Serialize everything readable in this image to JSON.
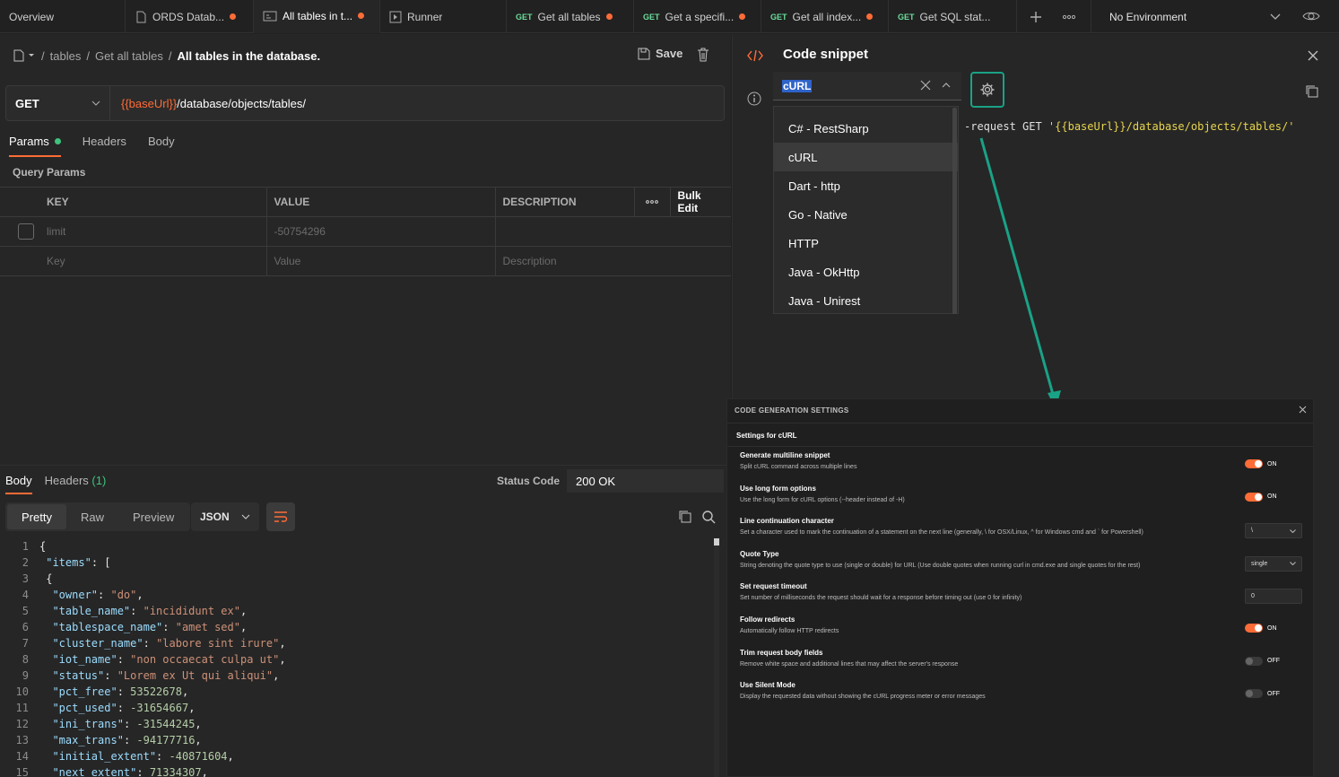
{
  "tabs": [
    {
      "label": "Overview",
      "method": "",
      "dirty": false,
      "active": false
    },
    {
      "label": "ORDS Datab...",
      "method": "",
      "dirty": true,
      "active": false
    },
    {
      "label": "All tables in t...",
      "method": "",
      "dirty": true,
      "active": true
    },
    {
      "label": "Runner",
      "method": "",
      "dirty": false,
      "active": false
    },
    {
      "label": "Get all tables",
      "method": "GET",
      "dirty": true,
      "active": false
    },
    {
      "label": "Get a specifi...",
      "method": "GET",
      "dirty": true,
      "active": false
    },
    {
      "label": "Get all index...",
      "method": "GET",
      "dirty": true,
      "active": false
    },
    {
      "label": "Get SQL stat...",
      "method": "GET",
      "dirty": false,
      "active": false
    }
  ],
  "environment": "No Environment",
  "breadcrumb": {
    "part1": "tables",
    "part2": "Get all tables",
    "current": "All tables in the database.",
    "sep": "/"
  },
  "save_label": "Save",
  "request": {
    "method": "GET",
    "url_var": "{{baseUrl}}",
    "url_path": "/database/objects/tables/"
  },
  "request_tabs": {
    "params": "Params",
    "headers": "Headers",
    "body": "Body"
  },
  "query_params": {
    "title": "Query Params",
    "headers": {
      "key": "KEY",
      "value": "VALUE",
      "description": "DESCRIPTION",
      "bulk_edit": "Bulk Edit"
    },
    "rows": [
      {
        "key": "limit",
        "value": "-50754296",
        "description": ""
      }
    ],
    "placeholders": {
      "key": "Key",
      "value": "Value",
      "description": "Description"
    }
  },
  "response": {
    "tab_body": "Body",
    "tab_headers": "Headers",
    "headers_count": "(1)",
    "status_label": "Status Code",
    "status_value": "200 OK",
    "formats": [
      "Pretty",
      "Raw",
      "Preview"
    ],
    "language": "JSON",
    "lines": [
      {
        "n": "1",
        "text": "{"
      },
      {
        "n": "2",
        "key": "\"items\"",
        "rest": ": ["
      },
      {
        "n": "3",
        "text": " {"
      },
      {
        "n": "4",
        "key": "\"owner\"",
        "str": "\"do\"",
        "end": ","
      },
      {
        "n": "5",
        "key": "\"table_name\"",
        "str": "\"incididunt ex\"",
        "end": ","
      },
      {
        "n": "6",
        "key": "\"tablespace_name\"",
        "str": "\"amet sed\"",
        "end": ","
      },
      {
        "n": "7",
        "key": "\"cluster_name\"",
        "str": "\"labore sint irure\"",
        "end": ","
      },
      {
        "n": "8",
        "key": "\"iot_name\"",
        "str": "\"non occaecat culpa ut\"",
        "end": ","
      },
      {
        "n": "9",
        "key": "\"status\"",
        "str": "\"Lorem ex Ut qui aliqui\"",
        "end": ","
      },
      {
        "n": "10",
        "key": "\"pct_free\"",
        "num": "53522678",
        "end": ","
      },
      {
        "n": "11",
        "key": "\"pct_used\"",
        "num": "-31654667",
        "end": ","
      },
      {
        "n": "12",
        "key": "\"ini_trans\"",
        "num": "-31544245",
        "end": ","
      },
      {
        "n": "13",
        "key": "\"max_trans\"",
        "num": "-94177716",
        "end": ","
      },
      {
        "n": "14",
        "key": "\"initial_extent\"",
        "num": "-40871604",
        "end": ","
      },
      {
        "n": "15",
        "key": "\"next_extent\"",
        "num": "71334307",
        "end": ","
      }
    ]
  },
  "code_snippet": {
    "title": "Code snippet",
    "language": "cURL",
    "snippet_prefix": "-request GET ",
    "snippet_url": "'{{baseUrl}}/database/objects/tables/'",
    "options": [
      "C# - RestSharp",
      "cURL",
      "Dart - http",
      "Go - Native",
      "HTTP",
      "Java - OkHttp",
      "Java - Unirest"
    ],
    "selected": "cURL"
  },
  "settings": {
    "header": "CODE GENERATION SETTINGS",
    "subtitle": "Settings for cURL",
    "rows": [
      {
        "name": "Generate multiline snippet",
        "desc": "Split cURL command across multiple lines",
        "type": "toggle",
        "on": true,
        "state": "ON"
      },
      {
        "name": "Use long form options",
        "desc": "Use the long form for cURL options (--header instead of -H)",
        "type": "toggle",
        "on": true,
        "state": "ON"
      },
      {
        "name": "Line continuation character",
        "desc": "Set a character used to mark the continuation of a statement on the next line (generally, \\ for OSX/Linux, ^ for Windows cmd and ` for Powershell)",
        "type": "select",
        "value": "\\"
      },
      {
        "name": "Quote Type",
        "desc": "String denoting the quote type to use (single or double) for URL (Use double quotes when running curl in cmd.exe and single quotes for the rest)",
        "type": "select",
        "value": "single"
      },
      {
        "name": "Set request timeout",
        "desc": "Set number of milliseconds the request should wait for a response before timing out (use 0 for infinity)",
        "type": "number",
        "value": "0"
      },
      {
        "name": "Follow redirects",
        "desc": "Automatically follow HTTP redirects",
        "type": "toggle",
        "on": true,
        "state": "ON"
      },
      {
        "name": "Trim request body fields",
        "desc": "Remove white space and additional lines that may affect the server's response",
        "type": "toggle",
        "on": false,
        "state": "OFF"
      },
      {
        "name": "Use Silent Mode",
        "desc": "Display the requested data without showing the cURL progress meter or error messages",
        "type": "toggle",
        "on": false,
        "state": "OFF"
      }
    ]
  },
  "colors": {
    "accent": "#ff6c37",
    "teal": "#1aa287",
    "success": "#3fc27d"
  }
}
